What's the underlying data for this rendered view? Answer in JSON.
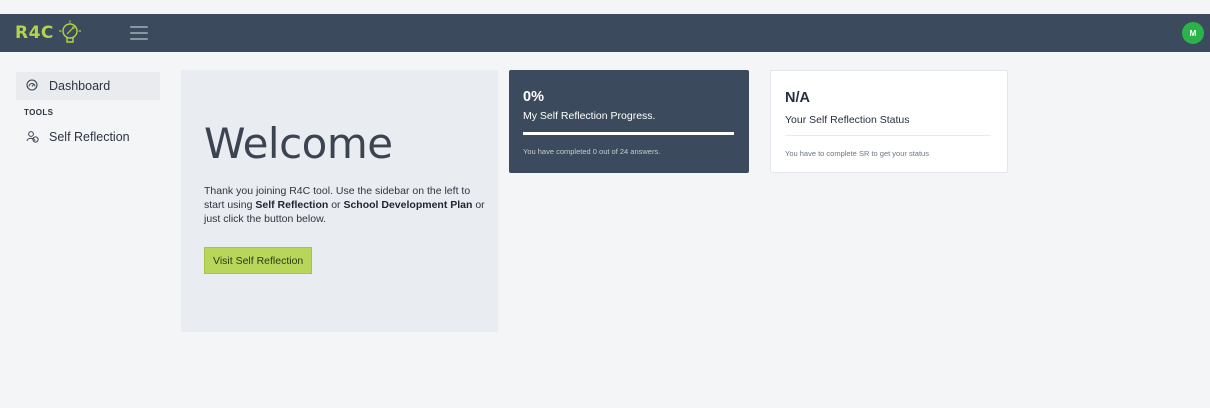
{
  "header": {
    "logo_text": "R4C",
    "avatar_initial": "M",
    "colors": {
      "bar": "#3b4a5c",
      "logo": "#b5d34a",
      "avatar": "#2cb24a"
    }
  },
  "sidebar": {
    "items": [
      {
        "label": "Dashboard",
        "icon": "dashboard-gauge-icon",
        "active": true
      }
    ],
    "section_heading": "TOOLS",
    "tools": [
      {
        "label": "Self Reflection",
        "icon": "users-icon"
      }
    ]
  },
  "welcome": {
    "title": "Welcome",
    "text_part1": "Thank you joining R4C tool. Use the sidebar on the left to start using ",
    "link1": "Self Reflection",
    "text_part2": " or ",
    "link2": "School Development Plan",
    "text_part3": " or just click the button below.",
    "button_label": "Visit Self Reflection"
  },
  "progress_card": {
    "value": "0%",
    "label": "My Self Reflection Progress.",
    "progress_fraction": 1.0,
    "note": "You have completed 0 out of 24 answers."
  },
  "status_card": {
    "value": "N/A",
    "label": "Your Self Reflection Status",
    "note": "You have to complete SR to get your status"
  }
}
